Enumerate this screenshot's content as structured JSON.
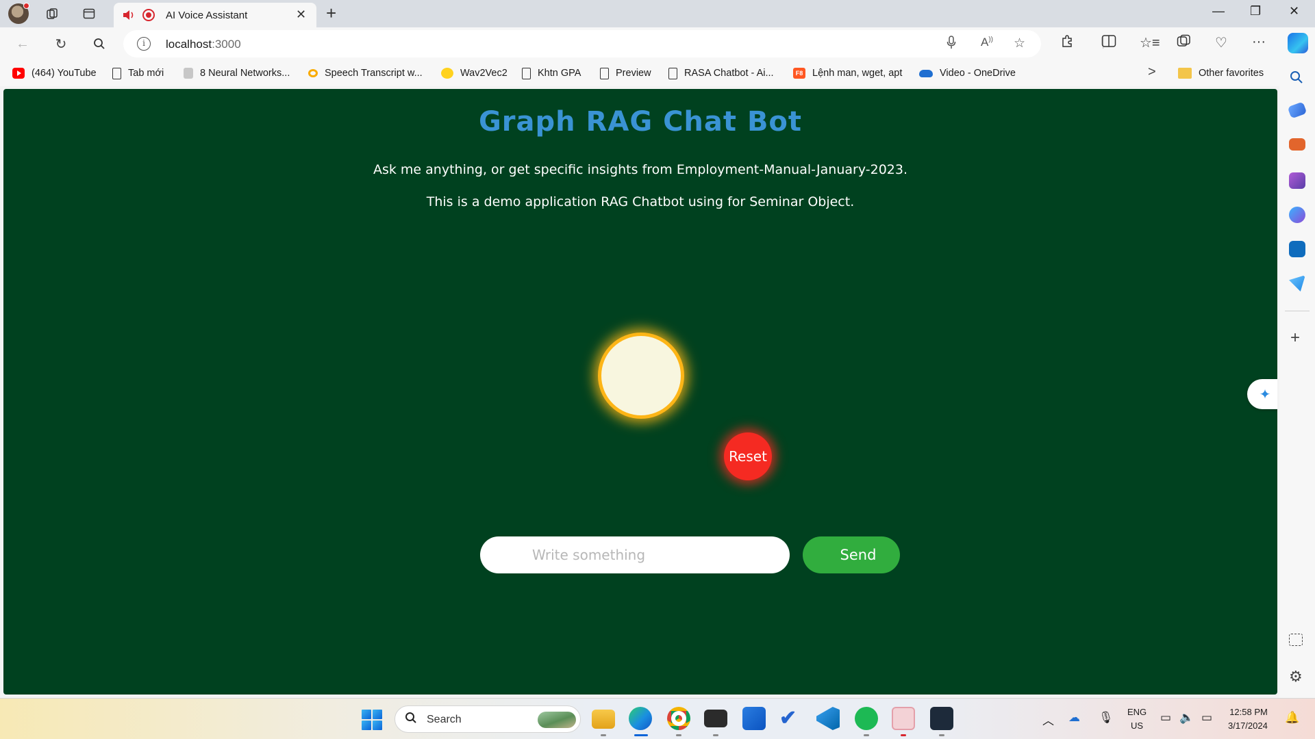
{
  "browser": {
    "tab": {
      "title": "AI Voice Assistant",
      "close": "✕"
    },
    "new_tab": "+",
    "window_controls": {
      "minimize": "—",
      "maximize": "❐",
      "close": "✕"
    },
    "nav": {
      "back": "←",
      "refresh": "↻",
      "search": "⚲"
    },
    "address": {
      "host": "localhost",
      "port": ":3000"
    },
    "favorites": [
      {
        "label": "(464) YouTube",
        "icon": "youtube-icon"
      },
      {
        "label": "Tab mới",
        "icon": "document-icon"
      },
      {
        "label": "8 Neural Networks...",
        "icon": "neural-net-icon"
      },
      {
        "label": "Speech Transcript w...",
        "icon": "colab-icon"
      },
      {
        "label": "Wav2Vec2",
        "icon": "huggingface-icon"
      },
      {
        "label": "Khtn GPA",
        "icon": "document-icon"
      },
      {
        "label": "Preview",
        "icon": "document-icon"
      },
      {
        "label": "RASA Chatbot - Ai...",
        "icon": "document-icon"
      },
      {
        "label": "Lệnh man, wget, apt",
        "icon": "f8-icon"
      },
      {
        "label": "Video - OneDrive",
        "icon": "onedrive-icon"
      }
    ],
    "favorites_more": ">",
    "other_favorites": "Other favorites",
    "f8_badge": "F8"
  },
  "app": {
    "title": "Graph RAG Chat Bot",
    "subtitle": "Ask me anything, or get specific insights from Employment-Manual-January-2023.",
    "description": "This is a demo application RAG Chatbot using for Seminar Object.",
    "reset_label": "Reset",
    "input_placeholder": "Write something",
    "input_value": "",
    "send_label": "Send",
    "colors": {
      "background": "#00411f",
      "title": "#3a93d4",
      "orb_border": "#fdb517",
      "reset": "#f52a22",
      "send": "#31ad3e"
    }
  },
  "taskbar": {
    "search_label": "Search",
    "lang": {
      "line1": "ENG",
      "line2": "US"
    },
    "time": "12:58 PM",
    "date": "3/17/2024"
  }
}
